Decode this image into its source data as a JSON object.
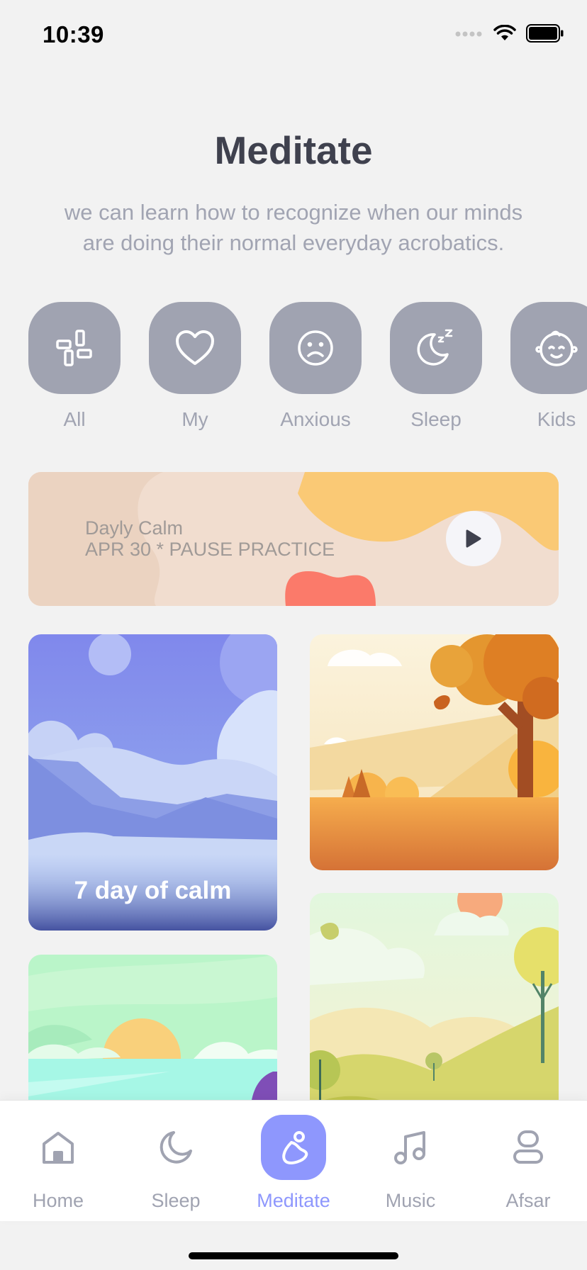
{
  "status_bar": {
    "time": "10:39"
  },
  "header": {
    "title": "Meditate",
    "subtitle": "we can learn how to recognize when our minds are doing their normal everyday acrobatics."
  },
  "categories": [
    {
      "label": "All",
      "icon": "grid-icon"
    },
    {
      "label": "My",
      "icon": "heart-icon"
    },
    {
      "label": "Anxious",
      "icon": "sad-face-icon"
    },
    {
      "label": "Sleep",
      "icon": "moon-sleep-icon"
    },
    {
      "label": "Kids",
      "icon": "baby-face-icon"
    }
  ],
  "banner": {
    "line1": "Dayly Calm",
    "line2": "APR 30 * PAUSE PRACTICE",
    "play_icon": "play-icon"
  },
  "cards": [
    {
      "label": "7 day of calm",
      "scene": "blue-mountains"
    },
    {
      "label": "",
      "scene": "autumn-tree"
    },
    {
      "label": "",
      "scene": "green-sunset-lake"
    },
    {
      "label": "",
      "scene": "green-hills"
    }
  ],
  "tabbar": {
    "active": "Meditate",
    "tabs": [
      {
        "label": "Home",
        "icon": "home-icon"
      },
      {
        "label": "Sleep",
        "icon": "moon-icon"
      },
      {
        "label": "Meditate",
        "icon": "meditate-icon"
      },
      {
        "label": "Music",
        "icon": "music-note-icon"
      },
      {
        "label": "Afsar",
        "icon": "profile-icon"
      }
    ]
  },
  "colors": {
    "accent": "#8e97fd",
    "category_button": "#a0a3b1",
    "title": "#3f414e",
    "subtitle": "#a1a4b2"
  }
}
